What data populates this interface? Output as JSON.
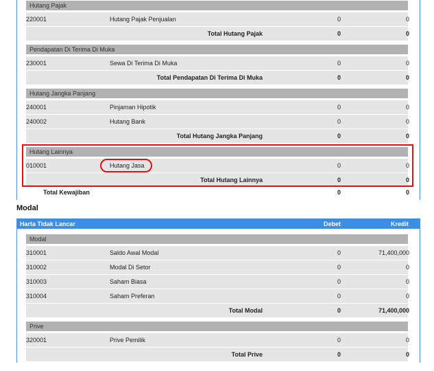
{
  "kewajiban": {
    "groups": [
      {
        "name": "Hutang Pajak",
        "rows": [
          {
            "code": "220001",
            "name": "Hutang Pajak Penjualan",
            "debet": "0",
            "kredit": "0"
          }
        ],
        "total_label": "Total Hutang Pajak",
        "total_debet": "0",
        "total_kredit": "0"
      },
      {
        "name": "Pendapatan Di Terima Di Muka",
        "rows": [
          {
            "code": "230001",
            "name": "Sewa Di Terima Di Muka",
            "debet": "0",
            "kredit": "0"
          }
        ],
        "total_label": "Total Pendapatan Di Terima Di Muka",
        "total_debet": "0",
        "total_kredit": "0"
      },
      {
        "name": "Hutang Jangka Panjang",
        "rows": [
          {
            "code": "240001",
            "name": "Pinjaman Hipotik",
            "debet": "0",
            "kredit": "0"
          },
          {
            "code": "240002",
            "name": "Hutang Bank",
            "debet": "0",
            "kredit": "0"
          }
        ],
        "total_label": "Total Hutang Jangka Panjang",
        "total_debet": "0",
        "total_kredit": "0"
      },
      {
        "name": "Hutang Lainnya",
        "rows": [
          {
            "code": "010001",
            "name": "Hutang Jasa",
            "debet": "0",
            "kredit": "0"
          }
        ],
        "total_label": "Total Hutang Lainnya",
        "total_debet": "0",
        "total_kredit": "0"
      }
    ],
    "grand_total_label": "Total Kewajiban",
    "grand_total_debet": "0",
    "grand_total_kredit": "0"
  },
  "modal": {
    "section_title": "Modal",
    "header": {
      "col1": "Harta Tidak Lancar",
      "col_debet": "Debet",
      "col_kredit": "Kredit"
    },
    "groups": [
      {
        "name": "Modal",
        "rows": [
          {
            "code": "310001",
            "name": "Saldo Awal Modal",
            "debet": "0",
            "kredit": "71,400,000"
          },
          {
            "code": "310002",
            "name": "Modal Di Setor",
            "debet": "0",
            "kredit": "0"
          },
          {
            "code": "310003",
            "name": "Saham Biasa",
            "debet": "0",
            "kredit": "0"
          },
          {
            "code": "310004",
            "name": "Saham Preferan",
            "debet": "0",
            "kredit": "0"
          }
        ],
        "total_label": "Total Modal",
        "total_debet": "0",
        "total_kredit": "71,400,000"
      },
      {
        "name": "Prive",
        "rows": [
          {
            "code": "320001",
            "name": "Prive Pemilik",
            "debet": "0",
            "kredit": "0"
          }
        ],
        "total_label": "Total Prive",
        "total_debet": "0",
        "total_kredit": "0"
      }
    ]
  },
  "colors": {
    "header_blue": "#3b8de6",
    "group_gray": "#b2b2b2",
    "row_gray": "#e5e5e5",
    "highlight_red": "#e01010"
  }
}
